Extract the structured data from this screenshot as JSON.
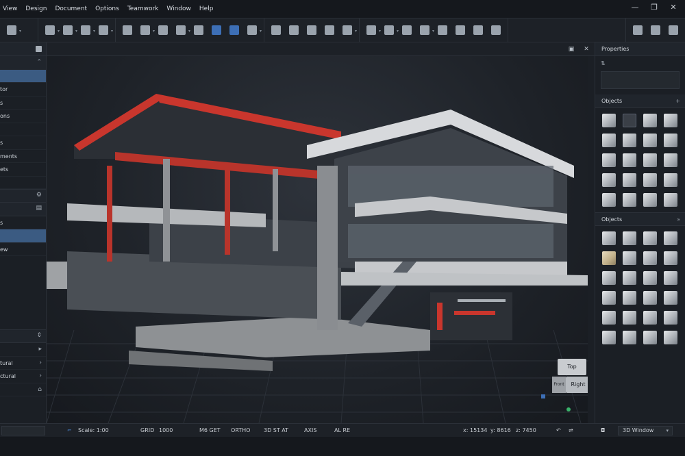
{
  "menu": {
    "items": [
      "View",
      "Design",
      "Document",
      "Options",
      "Teamwork",
      "Window",
      "Help"
    ]
  },
  "window_controls": {
    "minimize": "—",
    "restore": "❐",
    "close": "✕"
  },
  "left_panel": {
    "items": [
      {
        "label": "",
        "selected": true
      },
      {
        "label": "tor"
      },
      {
        "label": "s"
      },
      {
        "label": "ons"
      },
      {
        "label": ""
      },
      {
        "label": "s"
      },
      {
        "label": "ments"
      },
      {
        "label": "ets"
      },
      {
        "label": ""
      }
    ],
    "items2": [
      {
        "label": "s"
      },
      {
        "label": "",
        "selected": true
      },
      {
        "label": "ew"
      }
    ],
    "items3": [
      {
        "label": ""
      },
      {
        "label": "tural"
      },
      {
        "label": "ctural"
      },
      {
        "label": ""
      }
    ]
  },
  "right_panel": {
    "properties_title": "Properties",
    "objects_title_1": "Objects",
    "objects_title_2": "Objects"
  },
  "viewport": {
    "cube_top": "Top",
    "cube_right": "Right",
    "cube_front": "Front"
  },
  "status": {
    "scale": "Scale: 1:00",
    "grid_label": "GRID",
    "grid_value": "1000",
    "mode1": "M6 GET",
    "ortho": "ORTHO",
    "snap": "3D ST AT",
    "axis": "AXIS",
    "axis2": "AL RE",
    "x": "x: 15134",
    "y": "y: 8616",
    "z": "z: 7450",
    "window": "3D Window"
  }
}
